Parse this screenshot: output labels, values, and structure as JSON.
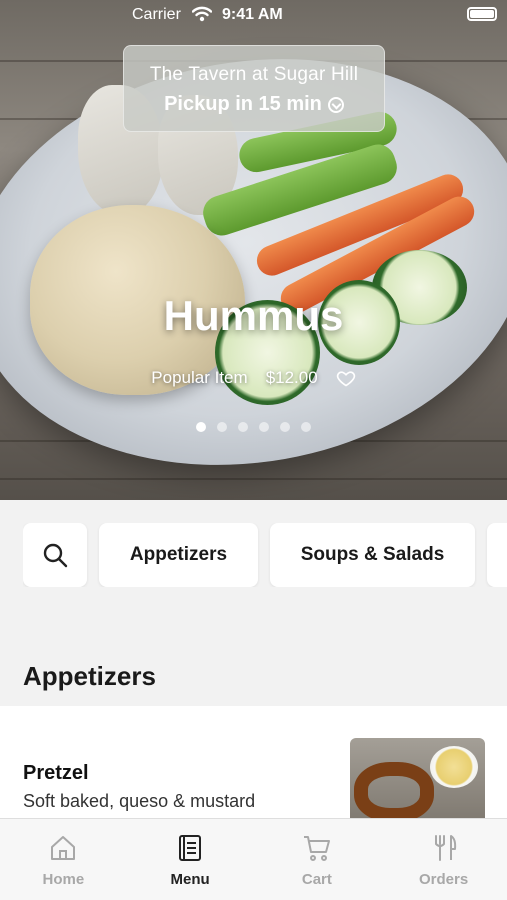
{
  "status_bar": {
    "carrier": "Carrier",
    "time": "9:41 AM"
  },
  "store": {
    "name": "The Tavern at Sugar Hill",
    "pickup": "Pickup in 15 min"
  },
  "hero": {
    "title": "Hummus",
    "badge": "Popular Item",
    "price": "$12.00",
    "carousel": {
      "total": 6,
      "active_index": 0
    }
  },
  "categories": {
    "search_icon": "search-icon",
    "items": [
      "Appetizers",
      "Soups & Salads",
      ""
    ]
  },
  "section": {
    "title": "Appetizers"
  },
  "menu_items": [
    {
      "name": "Pretzel",
      "description": "Soft baked, queso & mustard"
    }
  ],
  "tabs": [
    {
      "label": "Home",
      "icon": "home-icon",
      "active": false
    },
    {
      "label": "Menu",
      "icon": "menu-book-icon",
      "active": true
    },
    {
      "label": "Cart",
      "icon": "cart-icon",
      "active": false
    },
    {
      "label": "Orders",
      "icon": "fork-knife-icon",
      "active": false
    }
  ],
  "colors": {
    "active_tab": "#222222",
    "inactive_tab": "#a8a8a8",
    "background": "#f2f2f2"
  }
}
